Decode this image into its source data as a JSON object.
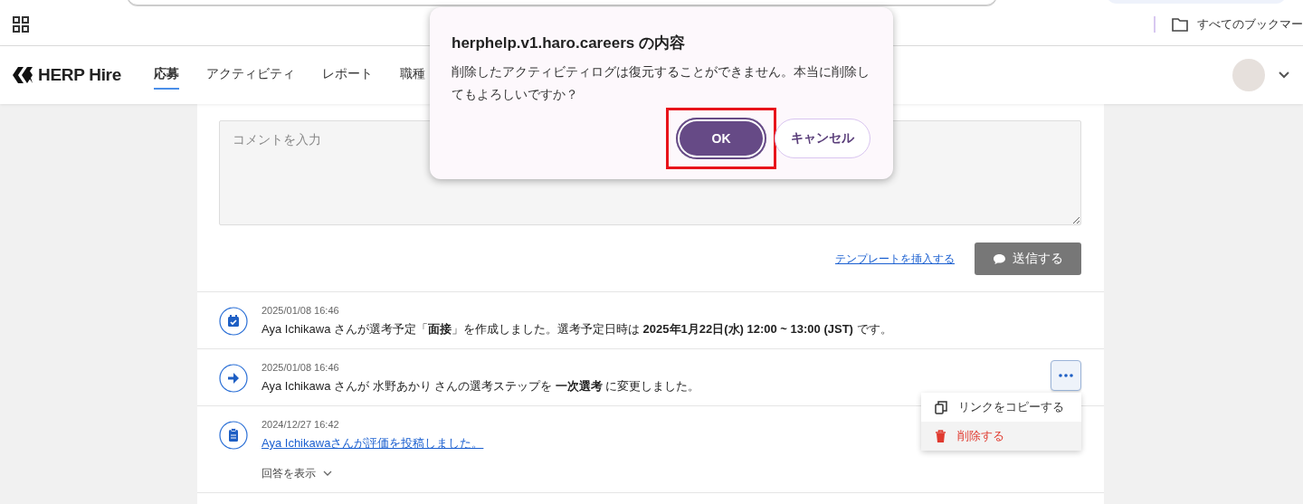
{
  "browser": {
    "bookmarks_folder": "すべてのブックマー"
  },
  "header": {
    "logo": "HERP Hire",
    "tabs": [
      {
        "label": "応募",
        "selected": true
      },
      {
        "label": "アクティビティ",
        "selected": false
      },
      {
        "label": "レポート",
        "selected": false
      },
      {
        "label": "職種",
        "selected": false
      }
    ]
  },
  "comment": {
    "placeholder": "コメントを入力",
    "template_link": "テンプレートを挿入する",
    "send_button": "送信する"
  },
  "activities": [
    {
      "kind": "calendar",
      "time": "2025/01/08 16:46",
      "text": "Aya Ichikawa さんが選考予定「**面接**」を作成しました。選考予定日時は **2025年1月22日(水) 12:00 ~ 13:00 (JST)** です。",
      "link": false,
      "menu_open": false
    },
    {
      "kind": "arrow",
      "time": "2025/01/08 16:46",
      "text": "Aya Ichikawa さんが 水野あかり さんの選考ステップを **一次選考** に変更しました。",
      "link": false,
      "menu_open": true
    },
    {
      "kind": "clipboard",
      "time": "2024/12/27 16:42",
      "text": "Aya Ichikawaさんが評価を投稿しました。",
      "link": true,
      "menu_open": false,
      "toggle": "回答を表示"
    }
  ],
  "menu": [
    {
      "kind": "copy",
      "label": "リンクをコピーする",
      "hovered": false
    },
    {
      "kind": "delete",
      "label": "削除する",
      "hovered": true
    }
  ],
  "dialog": {
    "title": "herphelp.v1.haro.careers の内容",
    "message": "削除したアクティビティログは復元することができません。本当に削除してもよろしいですか？",
    "ok_button": "OK",
    "ok_highlighted": true,
    "cancel_button": "キャンセル"
  }
}
